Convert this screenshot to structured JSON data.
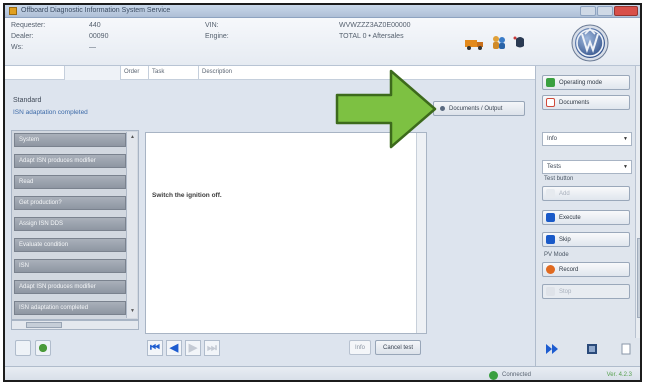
{
  "window": {
    "title": "Offboard Diagnostic Information System Service"
  },
  "vehicle_info": {
    "left_labels": [
      "Requester:",
      "Dealer:",
      "Ws:"
    ],
    "left_values": [
      "440",
      "00090",
      "—"
    ],
    "mid_labels": [
      "VIN:",
      "Engine:"
    ],
    "right_values": [
      "WVWZZZ3AZ0E00000",
      "TOTAL 0 • Aftersales"
    ]
  },
  "column_header": {
    "cells": [
      "",
      "",
      "Order",
      "Task",
      "Description"
    ]
  },
  "status": {
    "title": "Standard",
    "subtitle": "ISN adaptation completed"
  },
  "docu_button": {
    "label": "Documents / Output"
  },
  "steps": {
    "items": [
      "System",
      "Adapt ISN produces modifier",
      "Read",
      "Get production?",
      "Assign ISN DDS",
      "Evaluate condition",
      "ISN",
      "Adapt ISN produces modifier",
      "ISN adaptation completed"
    ]
  },
  "instruction": {
    "text": "Switch the ignition off."
  },
  "bottom_buttons": {
    "small": "Info",
    "cancel": "Cancel test"
  },
  "right_panel": {
    "button_top1": "Operating mode",
    "button_top2": "Documents",
    "select1": "Info",
    "select2": "Tests",
    "label_test_button": "Test button",
    "btn_disabled1": "Add",
    "btn_execute": "Execute",
    "btn_skip": "Skip",
    "label_pv": "PV Mode",
    "btn_record": "Record",
    "btn_disabled2": "Stop"
  },
  "statusbar": {
    "connection": "Connected",
    "version": "Ver. 4.2.3"
  },
  "colors": {
    "arrow": "#7dc142",
    "nav_blue": "#1d5cd0"
  }
}
